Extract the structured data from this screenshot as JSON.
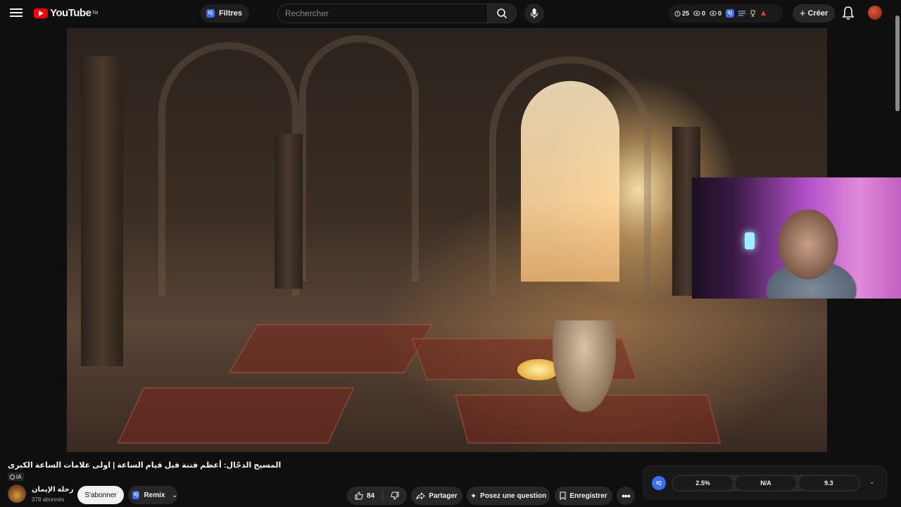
{
  "header": {
    "logo_text": "YouTube",
    "logo_tm": "TM",
    "filters_badge": "IQ",
    "filters_label": "Filtres",
    "search_placeholder": "Rechercher",
    "stats": {
      "views": "25",
      "val2": "0",
      "val3": "0",
      "badge": "IQ"
    },
    "create_label": "Créer"
  },
  "video": {
    "title": "المسيح الدجّال: أعظم فتنة قبل قيام الساعة | اولى علامات الساعة الكبرى",
    "ai_tag": "IA"
  },
  "channel": {
    "name": "رحلة الإيمان",
    "subscribers": "378 abonnés",
    "subscribe_label": "S'abonner",
    "remix_badge": "IQ",
    "remix_label": "Remix"
  },
  "actions": {
    "like_count": "84",
    "share_label": "Partager",
    "ask_label": "Posez une question",
    "save_label": "Enregistrer"
  },
  "rating_bar": {
    "badge": "IQ",
    "cells": [
      "2.5%",
      "N/A",
      "9.3"
    ]
  },
  "colors": {
    "brand_red": "#ff0000",
    "iq_blue": "#3b6df0",
    "background": "#0f0f0f",
    "chip": "#272727"
  }
}
